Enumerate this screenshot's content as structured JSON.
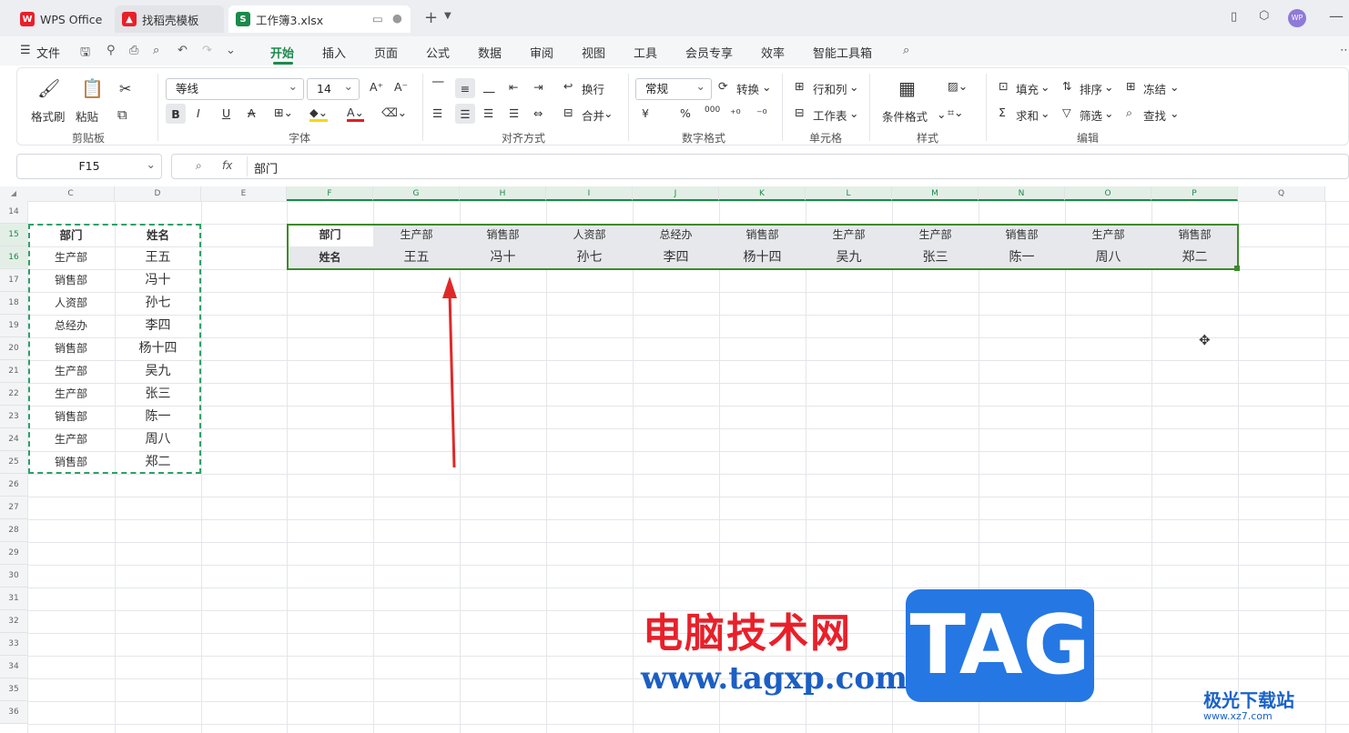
{
  "titlebar": {
    "tabs": [
      {
        "label": "WPS Office",
        "icon": "wps-logo-icon"
      },
      {
        "label": "找稻壳模板",
        "icon": "docer-icon"
      },
      {
        "label": "工作簿3.xlsx",
        "icon": "sheet-icon"
      }
    ],
    "new_tab": "+",
    "avatar": "WP"
  },
  "menu": {
    "file": "文件",
    "items": [
      "开始",
      "插入",
      "页面",
      "公式",
      "数据",
      "审阅",
      "视图",
      "工具",
      "会员专享",
      "效率",
      "智能工具箱"
    ]
  },
  "ribbon": {
    "clipboard": {
      "format_painter": "格式刷",
      "paste": "粘贴",
      "label": "剪贴板"
    },
    "font": {
      "name": "等线",
      "size": "14",
      "label": "字体"
    },
    "align": {
      "wrap": "换行",
      "merge": "合并",
      "label": "对齐方式"
    },
    "number": {
      "format": "常规",
      "convert": "转换",
      "label": "数字格式",
      "yen": "¥",
      "percent": "%",
      "thousands": "000"
    },
    "cells": {
      "rows_cols": "行和列",
      "sheet": "工作表",
      "label": "单元格"
    },
    "styles": {
      "conditional": "条件格式",
      "label": "样式"
    },
    "edit": {
      "fill": "填充",
      "sort": "排序",
      "freeze": "冻结",
      "sum": "求和",
      "filter": "筛选",
      "find": "查找",
      "label": "编辑"
    }
  },
  "formula": {
    "cell_ref": "F15",
    "fx": "fx",
    "value": "部门"
  },
  "columns": [
    "C",
    "D",
    "E",
    "F",
    "G",
    "H",
    "I",
    "J",
    "K",
    "L",
    "M",
    "N",
    "O",
    "P",
    "Q"
  ],
  "rows": [
    "14",
    "15",
    "16",
    "17",
    "18",
    "19",
    "20",
    "21",
    "22",
    "23",
    "24",
    "25",
    "26",
    "27",
    "28",
    "29",
    "30",
    "31",
    "32",
    "33",
    "34",
    "35",
    "36"
  ],
  "source_table": {
    "headers": [
      "部门",
      "姓名"
    ],
    "data": [
      [
        "生产部",
        "王五"
      ],
      [
        "销售部",
        "冯十"
      ],
      [
        "人资部",
        "孙七"
      ],
      [
        "总经办",
        "李四"
      ],
      [
        "销售部",
        "杨十四"
      ],
      [
        "生产部",
        "吴九"
      ],
      [
        "生产部",
        "张三"
      ],
      [
        "销售部",
        "陈一"
      ],
      [
        "生产部",
        "周八"
      ],
      [
        "销售部",
        "郑二"
      ]
    ]
  },
  "transposed_table": {
    "row_headers": [
      "部门",
      "姓名"
    ],
    "departments": [
      "生产部",
      "销售部",
      "人资部",
      "总经办",
      "销售部",
      "生产部",
      "生产部",
      "销售部",
      "生产部",
      "销售部"
    ],
    "names": [
      "王五",
      "冯十",
      "孙七",
      "李四",
      "杨十四",
      "吴九",
      "张三",
      "陈一",
      "周八",
      "郑二"
    ]
  },
  "watermark": {
    "cn": "电脑技术网",
    "url": "www.tagxp.com",
    "tag": "TAG",
    "site": "极光下载站",
    "site_url": "www.xz7.com"
  },
  "colors": {
    "accent": "#1b8a4a",
    "arrow": "#e02828"
  }
}
